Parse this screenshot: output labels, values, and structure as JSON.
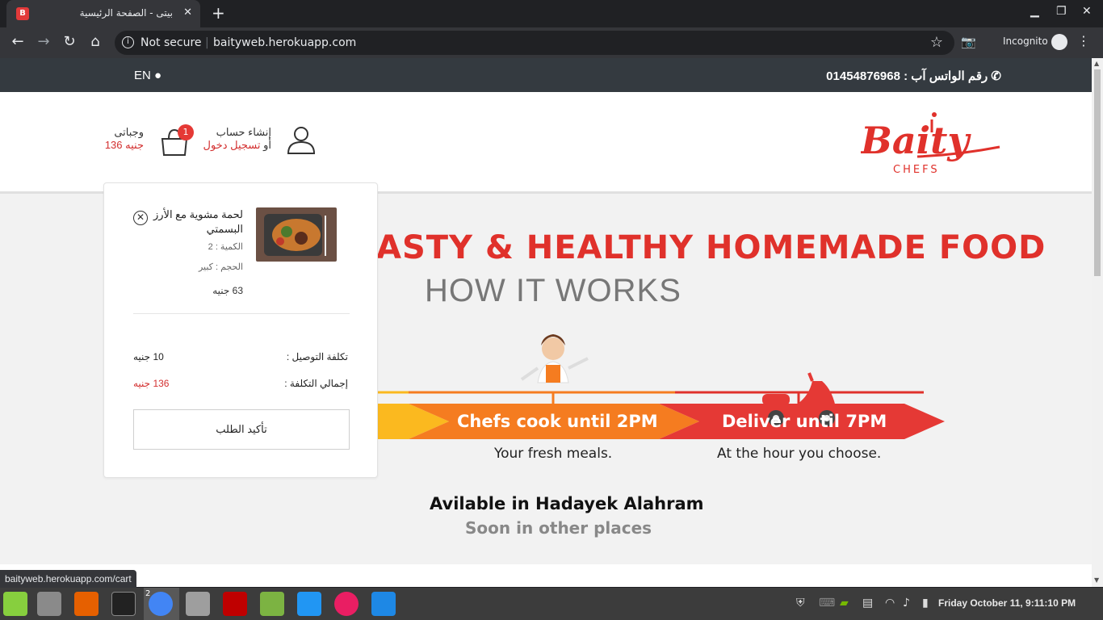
{
  "browser": {
    "tab_title": "بيتى - الصفحة الرئيسية",
    "new_tab": "+",
    "security": "Not secure",
    "url": "baityweb.herokuapp.com",
    "incognito": "Incognito",
    "status_url": "baityweb.herokuapp.com/cart"
  },
  "topbar": {
    "lang": "EN",
    "whatsapp": "رقم الواتس آب : 01454876968"
  },
  "header": {
    "logo_text": "Baity",
    "logo_sub": "CHEFS",
    "create_account": "إنشاء حساب",
    "or": "أو",
    "login": "تسجيل دخول",
    "cart_count": "1",
    "meals_label": "وجباتى",
    "meals_total": "136 جنيه"
  },
  "cart": {
    "item_name": "لحمة مشوية مع الأرز البسمتي",
    "item_qty": "الكمية : 2",
    "item_size": "الحجم : كبير",
    "item_price": "63 جنيه",
    "delivery_label": "تكلفة التوصيل :",
    "delivery_value": "10 جنيه",
    "total_label": "إجمالي التكلفة :",
    "total_value": "136 جنيه",
    "confirm": "تأكيد الطلب"
  },
  "hero": {
    "title": "ASTY & HEALTHY HOMEMADE FOOD",
    "subtitle": "HOW IT WORKS",
    "step2": "Chefs cook until 2PM",
    "step2_sub": "Your fresh meals.",
    "step3": "Deliver until 7PM",
    "step3_sub": "At the hour you choose.",
    "available": "Avilable in Hadayek Alahram",
    "soon": "Soon in other places"
  },
  "taskbar": {
    "chrome_badge": "2",
    "clock": "Friday October 11,  9:11:10 PM"
  },
  "colors": {
    "brand_red": "#e0312b",
    "orange": "#f57c20",
    "yellow": "#fbb91f"
  }
}
